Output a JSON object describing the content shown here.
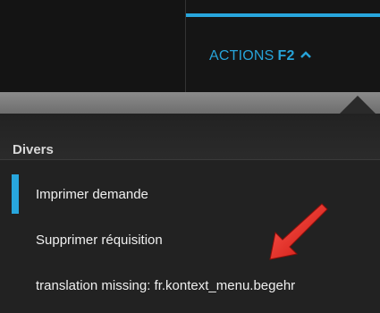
{
  "actions_tab": {
    "label": "ACTIONS",
    "shortcut": "F2"
  },
  "menu": {
    "section_title": "Divers",
    "items": [
      {
        "label": "Imprimer demande"
      },
      {
        "label": "Supprimer réquisition"
      },
      {
        "label": "translation missing: fr.kontext_menu.begehr"
      }
    ]
  },
  "colors": {
    "accent": "#28a6dd",
    "arrow": "#e8221c"
  },
  "icons": {
    "tab_chevron": "chevron-up-icon",
    "annotation": "red-arrow-annotation"
  }
}
